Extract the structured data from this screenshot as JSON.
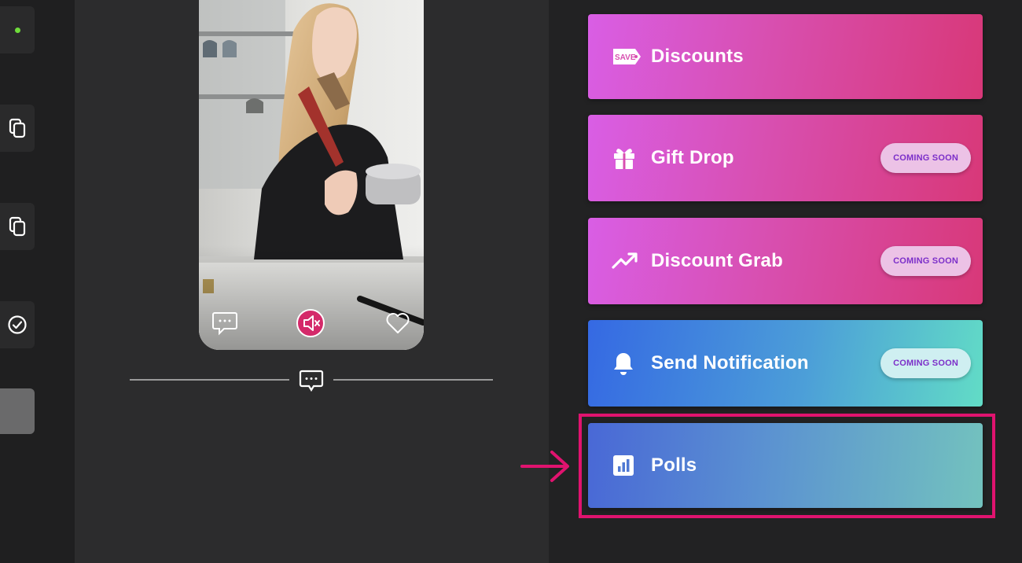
{
  "cards": [
    {
      "title": "Discounts",
      "icon": "save-tag-icon",
      "icon_text": "SAVE",
      "badge": ""
    },
    {
      "title": "Gift Drop",
      "icon": "gift-icon",
      "badge": "COMING SOON"
    },
    {
      "title": "Discount Grab",
      "icon": "trending-up-icon",
      "badge": "COMING SOON"
    },
    {
      "title": "Send Notification",
      "icon": "bell-icon",
      "badge": "COMING SOON"
    },
    {
      "title": "Polls",
      "icon": "poll-chart-icon",
      "badge": ""
    }
  ],
  "colors": {
    "accent_highlight": "#e0136f",
    "status_dot": "#6fdc3b",
    "badge_text": "#7c2fc9"
  }
}
